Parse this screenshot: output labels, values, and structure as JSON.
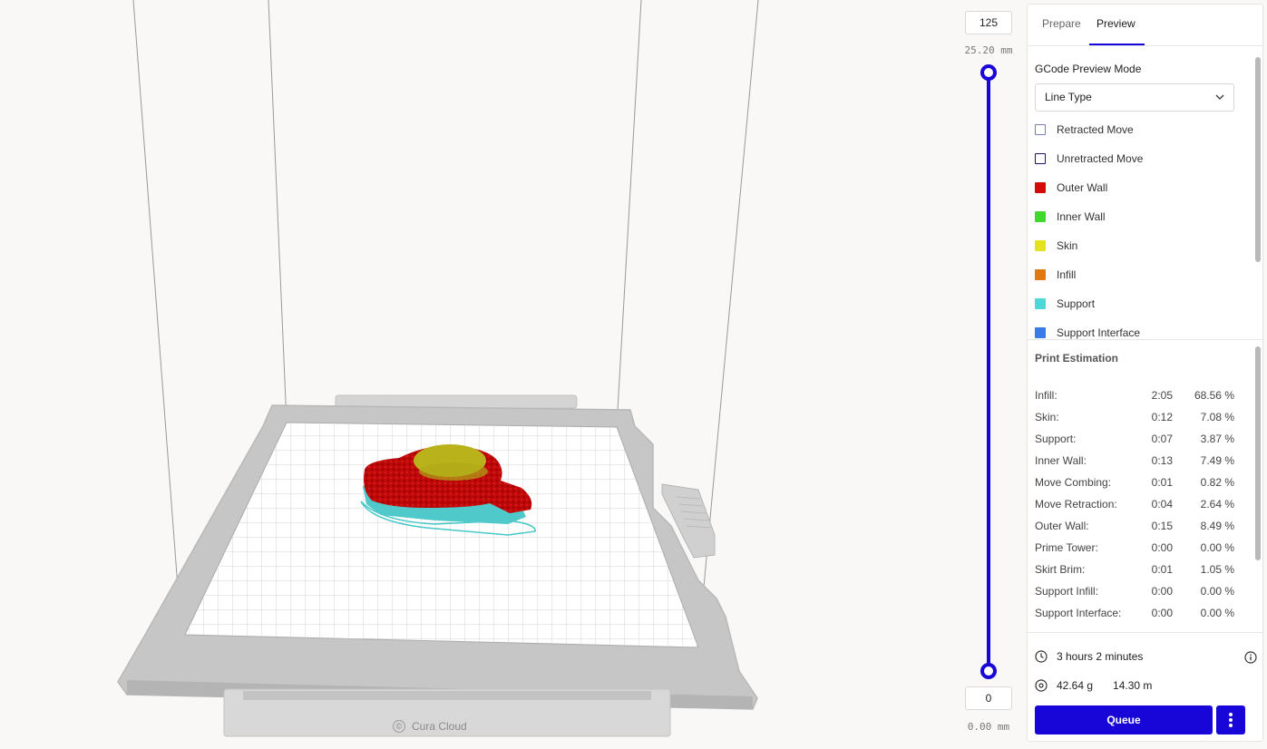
{
  "viewport": {
    "watermark": "Cura Cloud"
  },
  "layer_slider": {
    "top_layer": "125",
    "top_height": "25.20 mm",
    "bottom_layer": "0",
    "bottom_height": "0.00 mm"
  },
  "panel": {
    "tabs": [
      {
        "label": "Prepare"
      },
      {
        "label": "Preview",
        "active": true
      }
    ],
    "gcode_preview_mode": {
      "title": "GCode Preview Mode",
      "selected": "Line Type"
    },
    "legend": [
      {
        "label": "Retracted Move",
        "color": "#ffffff",
        "border": "#7a7fb0"
      },
      {
        "label": "Unretracted Move",
        "color": "#ffffff",
        "border": "#1a1070"
      },
      {
        "label": "Outer Wall",
        "color": "#d40a0a"
      },
      {
        "label": "Inner Wall",
        "color": "#40d82c"
      },
      {
        "label": "Skin",
        "color": "#e4e21c"
      },
      {
        "label": "Infill",
        "color": "#e07a10"
      },
      {
        "label": "Support",
        "color": "#4ed8d8"
      },
      {
        "label": "Support Interface",
        "color": "#3a7ae8"
      }
    ],
    "print_estimation": {
      "title": "Print Estimation",
      "rows": [
        {
          "label": "Infill:",
          "time": "2:05",
          "percent": "68.56 %"
        },
        {
          "label": "Skin:",
          "time": "0:12",
          "percent": "7.08 %"
        },
        {
          "label": "Support:",
          "time": "0:07",
          "percent": "3.87 %"
        },
        {
          "label": "Inner Wall:",
          "time": "0:13",
          "percent": "7.49 %"
        },
        {
          "label": "Move Combing:",
          "time": "0:01",
          "percent": "0.82 %"
        },
        {
          "label": "Move Retraction:",
          "time": "0:04",
          "percent": "2.64 %"
        },
        {
          "label": "Outer Wall:",
          "time": "0:15",
          "percent": "8.49 %"
        },
        {
          "label": "Prime Tower:",
          "time": "0:00",
          "percent": "0.00 %"
        },
        {
          "label": "Skirt Brim:",
          "time": "0:01",
          "percent": "1.05 %"
        },
        {
          "label": "Support Infill:",
          "time": "0:00",
          "percent": "0.00 %"
        },
        {
          "label": "Support Interface:",
          "time": "0:00",
          "percent": "0.00 %"
        }
      ]
    },
    "summary": {
      "duration": "3 hours 2 minutes",
      "weight": "42.64 g",
      "length": "14.30 m"
    },
    "queue_label": "Queue"
  },
  "colors": {
    "accent": "#1806d8"
  },
  "icons": [
    "clock-icon",
    "info-icon",
    "spool-icon",
    "chevron-down-icon",
    "more-vertical-icon",
    "cura-cloud-icon"
  ]
}
